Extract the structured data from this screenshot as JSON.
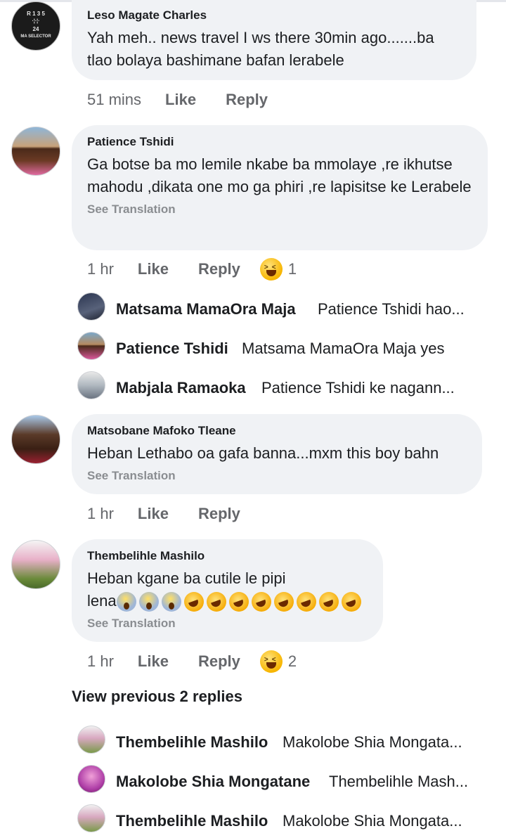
{
  "comments": [
    {
      "author": "Leso Magate Charles",
      "text": "Yah meh.. news travel I ws there 30min ago.......ba tlao bolaya bashimane bafan lerabele",
      "avatar_text": [
        "R 1 3 5",
        "24",
        "MA SELECTOR"
      ],
      "time": "51 mins",
      "like": "Like",
      "reply": "Reply"
    },
    {
      "author": "Patience Tshidi",
      "text": "Ga botse ba mo lemile nkabe ba mmolaye ,re ikhutse mahodu ,dikata one mo ga phiri ,re lapisitse ke Lerabele",
      "see_translation": "See Translation",
      "time": "1 hr",
      "like": "Like",
      "reply": "Reply",
      "reaction_icon": "laughing-emoji-icon",
      "reaction_count": "1",
      "replies": [
        {
          "name": "Matsama MamaOra Maja",
          "text": "Patience Tshidi hao..."
        },
        {
          "name": "Patience Tshidi",
          "text": "Matsama MamaOra Maja yes"
        },
        {
          "name": "Mabjala Ramaoka",
          "text": "Patience Tshidi ke nagann..."
        }
      ]
    },
    {
      "author": "Matsobane Mafoko Tleane",
      "text": "Heban Lethabo oa gafa banna...mxm this boy bahn",
      "see_translation": "See Translation",
      "time": "1 hr",
      "like": "Like",
      "reply": "Reply"
    },
    {
      "author": "Thembelihle Mashilo",
      "text": "Heban kgane ba cutile le pipi",
      "text_line2": "lena",
      "emojis": [
        "scream",
        "scream",
        "scream",
        "rofl",
        "rofl",
        "rofl",
        "rofl",
        "rofl",
        "rofl",
        "rofl",
        "rofl"
      ],
      "see_translation": "See Translation",
      "time": "1 hr",
      "like": "Like",
      "reply": "Reply",
      "reaction_icon": "laughing-emoji-icon",
      "reaction_count": "2",
      "view_previous": "View previous 2 replies",
      "replies": [
        {
          "name": "Thembelihle Mashilo",
          "text": "Makolobe Shia Mongata..."
        },
        {
          "name": "Makolobe Shia Mongatane",
          "text": "Thembelihle Mash..."
        },
        {
          "name": "Thembelihle Mashilo",
          "text": "Makolobe Shia Mongata..."
        }
      ]
    }
  ],
  "colors": {
    "bubble": "#f0f2f5",
    "meta": "#65676b",
    "translation": "#8a8d91"
  }
}
